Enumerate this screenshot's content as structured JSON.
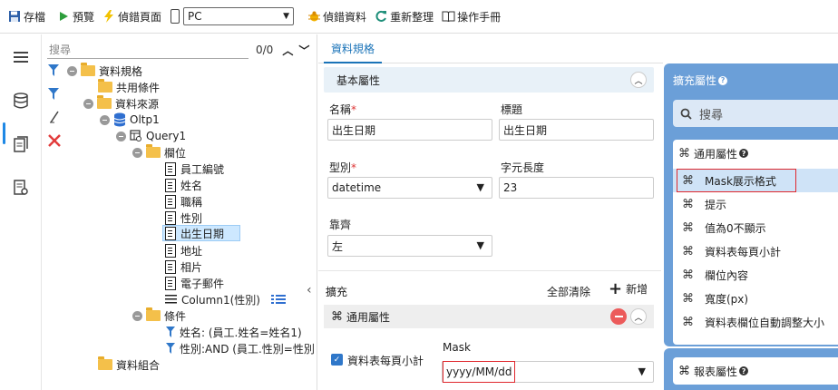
{
  "toolbar": {
    "save": "存檔",
    "preview": "預覽",
    "debug_page": "偵錯頁面",
    "device_value": "PC",
    "debug_data": "偵錯資料",
    "reorganize": "重新整理",
    "manual": "操作手冊"
  },
  "tree": {
    "search_placeholder": "搜尋",
    "count": "0/0",
    "nodes": [
      {
        "label": "資料規格"
      },
      {
        "label": "共用條件"
      },
      {
        "label": "資料來源"
      },
      {
        "label": "Oltp1"
      },
      {
        "label": "Query1"
      },
      {
        "label": "欄位"
      },
      {
        "label": "員工編號"
      },
      {
        "label": "姓名"
      },
      {
        "label": "職稱"
      },
      {
        "label": "性別"
      },
      {
        "label": "出生日期"
      },
      {
        "label": "地址"
      },
      {
        "label": "相片"
      },
      {
        "label": "電子郵件"
      },
      {
        "label": "Column1(性別)"
      },
      {
        "label": "條件"
      },
      {
        "label": "姓名: (員工.姓名=姓名1)"
      },
      {
        "label": "性別:AND (員工.性別=性別"
      },
      {
        "label": "資料組合"
      }
    ]
  },
  "tab": {
    "label": "資料規格"
  },
  "basic": {
    "title": "基本屬性",
    "name_label": "名稱",
    "name_value": "出生日期",
    "caption_label": "標題",
    "caption_value": "出生日期",
    "type_label": "型別",
    "type_value": "datetime",
    "length_label": "字元長度",
    "length_value": "23",
    "align_label": "靠齊",
    "align_value": "左"
  },
  "extend": {
    "label": "擴充",
    "clear_all": "全部清除",
    "add": "新增",
    "section_title": "通用屬性",
    "checkbox_label": "資料表每頁小計",
    "mask_label": "Mask",
    "mask_value": "yyyy/MM/dd"
  },
  "right": {
    "title": "擴充屬性",
    "search": "搜尋",
    "group_title": "通用屬性",
    "items": [
      {
        "label": "Mask展示格式"
      },
      {
        "label": "提示"
      },
      {
        "label": "值為0不顯示"
      },
      {
        "label": "資料表每頁小計"
      },
      {
        "label": "欄位內容"
      },
      {
        "label": "寬度(px)"
      },
      {
        "label": "資料表欄位自動調整大小"
      }
    ],
    "report_title": "報表屬性"
  },
  "colors": {
    "accent": "#1a73b8",
    "panel": "#6b9fd8",
    "highlight": "#e0282e"
  }
}
